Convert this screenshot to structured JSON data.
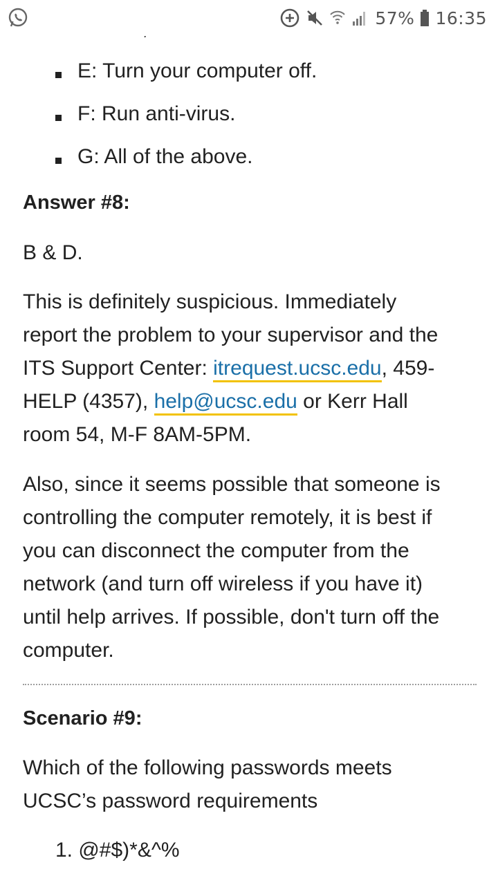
{
  "status_bar": {
    "battery_percent": "57%",
    "time": "16:35",
    "icons": [
      "whatsapp-icon",
      "data-saver-icon",
      "mute-icon",
      "wifi-icon",
      "signal-icon",
      "battery-icon"
    ]
  },
  "list_e_g": [
    "E: Turn your computer off.",
    "F: Run anti-virus.",
    "G: All of the above."
  ],
  "answer8": {
    "heading": "Answer #8:",
    "short": "B & D.",
    "para1": {
      "line1": "This is definitely suspicious. Immediately",
      "line2": "report the problem to your supervisor and the",
      "line3_pre": "ITS Support Center: ",
      "link1": "itrequest.ucsc.edu",
      "line3_post": ", 459-",
      "line4_pre": "HELP (4357), ",
      "link2": "help@ucsc.edu",
      "line4_post": " or Kerr Hall",
      "line5": "room 54, M-F 8AM-5PM."
    },
    "para2": [
      "Also, since it seems possible that someone is",
      "controlling the computer remotely, it is best if",
      "you can disconnect the computer from the",
      "network (and turn off wireless if you have it)",
      "until help arrives. If possible, don't turn off the",
      "computer."
    ]
  },
  "scenario9": {
    "heading": "Scenario #9:",
    "question": [
      "Which of the following passwords meets",
      "UCSC’s password requirements"
    ],
    "options": [
      "1. @#$)*&^%"
    ]
  },
  "colors": {
    "link": "#1a6fa8",
    "link_underline": "#f2c200",
    "text": "#212121"
  }
}
